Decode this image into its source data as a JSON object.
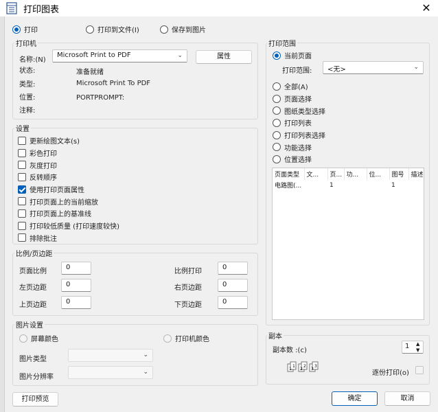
{
  "window": {
    "title": "打印图表",
    "close": "✕"
  },
  "output_mode": [
    {
      "label": "打印",
      "checked": true
    },
    {
      "label": "打印到文件(I)",
      "checked": false
    },
    {
      "label": "保存到图片",
      "checked": false
    }
  ],
  "printer": {
    "legend": "打印机",
    "name_label": "名称:(N)",
    "name_value": "Microsoft Print to PDF",
    "properties_button": "属性",
    "status_label": "状态:",
    "status_value": "准备就绪",
    "type_label": "类型:",
    "type_value": "Microsoft Print To PDF",
    "location_label": "位置:",
    "location_value": "PORTPROMPT:",
    "comment_label": "注释:",
    "comment_value": ""
  },
  "settings": {
    "legend": "设置",
    "items": [
      {
        "label": "更新绘图文本(s)",
        "checked": false
      },
      {
        "label": "彩色打印",
        "checked": false
      },
      {
        "label": "灰度打印",
        "checked": false
      },
      {
        "label": "反转顺序",
        "checked": false
      },
      {
        "label": "使用打印页面属性",
        "checked": true
      },
      {
        "label": "打印页面上的当前缩放",
        "checked": false
      },
      {
        "label": "打印页面上的基准线",
        "checked": false
      },
      {
        "label": "打印较低质量 (打印速度较快)",
        "checked": false
      },
      {
        "label": "排除批注",
        "checked": false
      }
    ]
  },
  "scale_margins": {
    "legend": "比例/页边距",
    "page_scale_label": "页面比例",
    "page_scale_value": "0",
    "print_scale_label": "比例打印",
    "print_scale_value": "0",
    "left_margin_label": "左页边距",
    "left_margin_value": "0",
    "right_margin_label": "右页边距",
    "right_margin_value": "0",
    "top_margin_label": "上页边距",
    "top_margin_value": "0",
    "bottom_margin_label": "下页边距",
    "bottom_margin_value": "0"
  },
  "image_settings": {
    "legend": "图片设置",
    "screen_color": "屏幕颜色",
    "printer_color": "打印机颜色",
    "image_type_label": "图片类型",
    "image_resolution_label": "图片分辨率"
  },
  "print_range": {
    "legend": "打印范围",
    "current_page": "当前页面",
    "range_label": "打印范围:",
    "range_value": "<无>",
    "options": [
      {
        "label": "全部(A)"
      },
      {
        "label": "页面选择"
      },
      {
        "label": "图纸类型选择"
      },
      {
        "label": "打印列表"
      },
      {
        "label": "打印列表选择"
      },
      {
        "label": "功能选择"
      },
      {
        "label": "位置选择"
      }
    ],
    "table": {
      "columns": [
        "页面类型",
        "文...",
        "页...",
        "功...",
        "位...",
        "图号",
        "描述"
      ],
      "rows": [
        [
          "电路图(...",
          "",
          "1",
          "",
          "",
          "1",
          ""
        ]
      ]
    }
  },
  "copies": {
    "legend": "副本",
    "count_label": "副本数 :(c)",
    "count_value": "1",
    "collate_label": "逐份打印(o)",
    "collate_icon_text": [
      "1",
      "1",
      "2",
      "2",
      "3",
      "3"
    ]
  },
  "buttons": {
    "preview": "打印预览",
    "ok": "确定",
    "cancel": "取消"
  },
  "colors": {
    "accent": "#005fb8"
  }
}
